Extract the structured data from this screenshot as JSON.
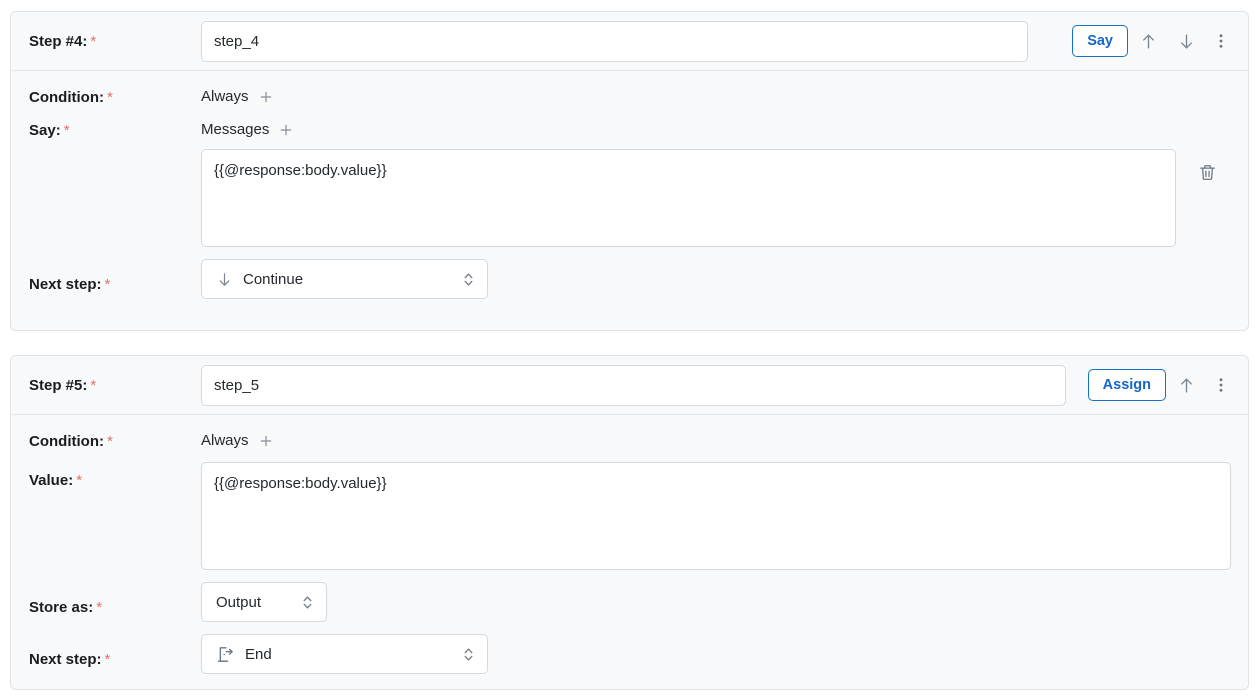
{
  "steps": [
    {
      "id": "step4",
      "header": {
        "label": "Step #4:",
        "required_marker": "*",
        "name_value": "step_4",
        "name_placeholder": "Step name",
        "action_button": "Say",
        "icons": [
          "arrow-up-icon",
          "arrow-down-icon",
          "kebab-menu-icon"
        ]
      },
      "condition": {
        "label": "Condition:",
        "required_marker": "*",
        "value": "Always",
        "add_icon": "plus-icon"
      },
      "say": {
        "label": "Say:",
        "required_marker": "*",
        "group_label": "Messages",
        "add_icon": "plus-icon",
        "message_value": "{{@response:body.value}}",
        "message_placeholder": "Enter a message",
        "delete_icon": "trash-icon"
      },
      "next_step": {
        "label": "Next step:",
        "required_marker": "*",
        "value": "Continue",
        "lead_icon": "arrow-down-icon",
        "chevron_icon": "chevron-updown-icon"
      }
    },
    {
      "id": "step5",
      "header": {
        "label": "Step #5:",
        "required_marker": "*",
        "name_value": "step_5",
        "name_placeholder": "Step name",
        "action_button": "Assign",
        "icons": [
          "arrow-up-icon",
          "kebab-menu-icon"
        ]
      },
      "condition": {
        "label": "Condition:",
        "required_marker": "*",
        "value": "Always",
        "add_icon": "plus-icon"
      },
      "value_field": {
        "label": "Value:",
        "required_marker": "*",
        "value": "{{@response:body.value}}",
        "placeholder": "Enter a value"
      },
      "store_as": {
        "label": "Store as:",
        "required_marker": "*",
        "value": "Output",
        "chevron_icon": "chevron-updown-icon"
      },
      "next_step": {
        "label": "Next step:",
        "required_marker": "*",
        "value": "End",
        "lead_icon": "exit-door-icon",
        "chevron_icon": "chevron-updown-icon"
      }
    }
  ],
  "colors": {
    "accent_blue": "#1668c4",
    "required_red": "#e8706a",
    "card_background": "#f7f9fa",
    "card_border": "#dfe3e8",
    "input_border": "#d4d9de",
    "icon_gray": "#6b7683",
    "text": "#24292f"
  }
}
